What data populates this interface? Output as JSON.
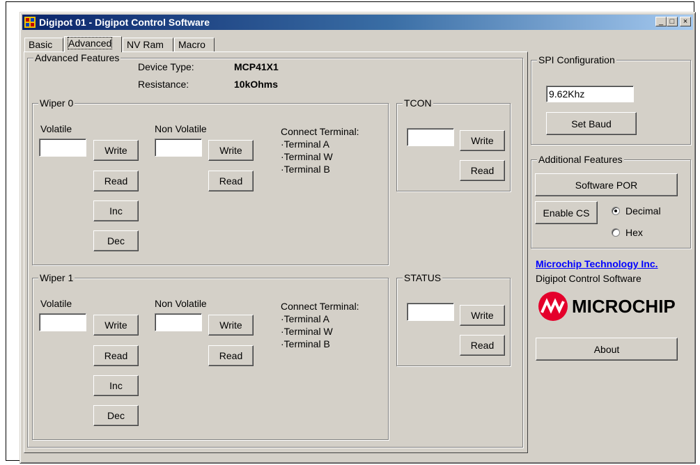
{
  "window": {
    "title": "Digipot 01 - Digipot Control Software",
    "controls": {
      "minimize": "_",
      "maximize": "□",
      "close": "×"
    }
  },
  "tabs": [
    {
      "label": "Basic"
    },
    {
      "label": "Advanced",
      "active": true
    },
    {
      "label": "NV Ram"
    },
    {
      "label": "Macro"
    }
  ],
  "advanced": {
    "group_label": "Advanced Features",
    "device_type_label": "Device Type:",
    "device_type_value": "MCP41X1",
    "resistance_label": "Resistance:",
    "resistance_value": "10kOhms"
  },
  "wiper0": {
    "label": "Wiper 0",
    "volatile_label": "Volatile",
    "volatile_value": "",
    "nonvolatile_label": "Non Volatile",
    "nonvolatile_value": "",
    "buttons": {
      "write": "Write",
      "read": "Read",
      "inc": "Inc",
      "dec": "Dec",
      "nv_write": "Write",
      "nv_read": "Read"
    },
    "connect": {
      "title": "Connect Terminal:",
      "a": "·Terminal A",
      "w": "·Terminal W",
      "b": "·Terminal B"
    }
  },
  "wiper1": {
    "label": "Wiper 1",
    "volatile_label": "Volatile",
    "volatile_value": "",
    "nonvolatile_label": "Non Volatile",
    "nonvolatile_value": "",
    "buttons": {
      "write": "Write",
      "read": "Read",
      "inc": "Inc",
      "dec": "Dec",
      "nv_write": "Write",
      "nv_read": "Read"
    },
    "connect": {
      "title": "Connect Terminal:",
      "a": "·Terminal A",
      "w": "·Terminal W",
      "b": "·Terminal B"
    }
  },
  "tcon": {
    "label": "TCON",
    "value": "",
    "write": "Write",
    "read": "Read"
  },
  "status": {
    "label": "STATUS",
    "value": "",
    "write": "Write",
    "read": "Read"
  },
  "spi": {
    "label": "SPI Configuration",
    "baud_value": "9.62Khz",
    "set_baud": "Set Baud"
  },
  "additional": {
    "label": "Additional Features",
    "software_por": "Software POR",
    "enable_cs": "Enable CS",
    "decimal": "Decimal",
    "hex": "Hex",
    "selected_format": "Decimal"
  },
  "about": {
    "company_link": "Microchip Technology Inc.",
    "software_name": "Digipot Control Software",
    "logo_text": "MICROCHIP",
    "about_button": "About"
  },
  "colors": {
    "titlebar_start": "#0a246a",
    "titlebar_end": "#a6caf0",
    "face": "#d4d0c8",
    "logo_red": "#e4002b",
    "link": "#0000ff"
  }
}
